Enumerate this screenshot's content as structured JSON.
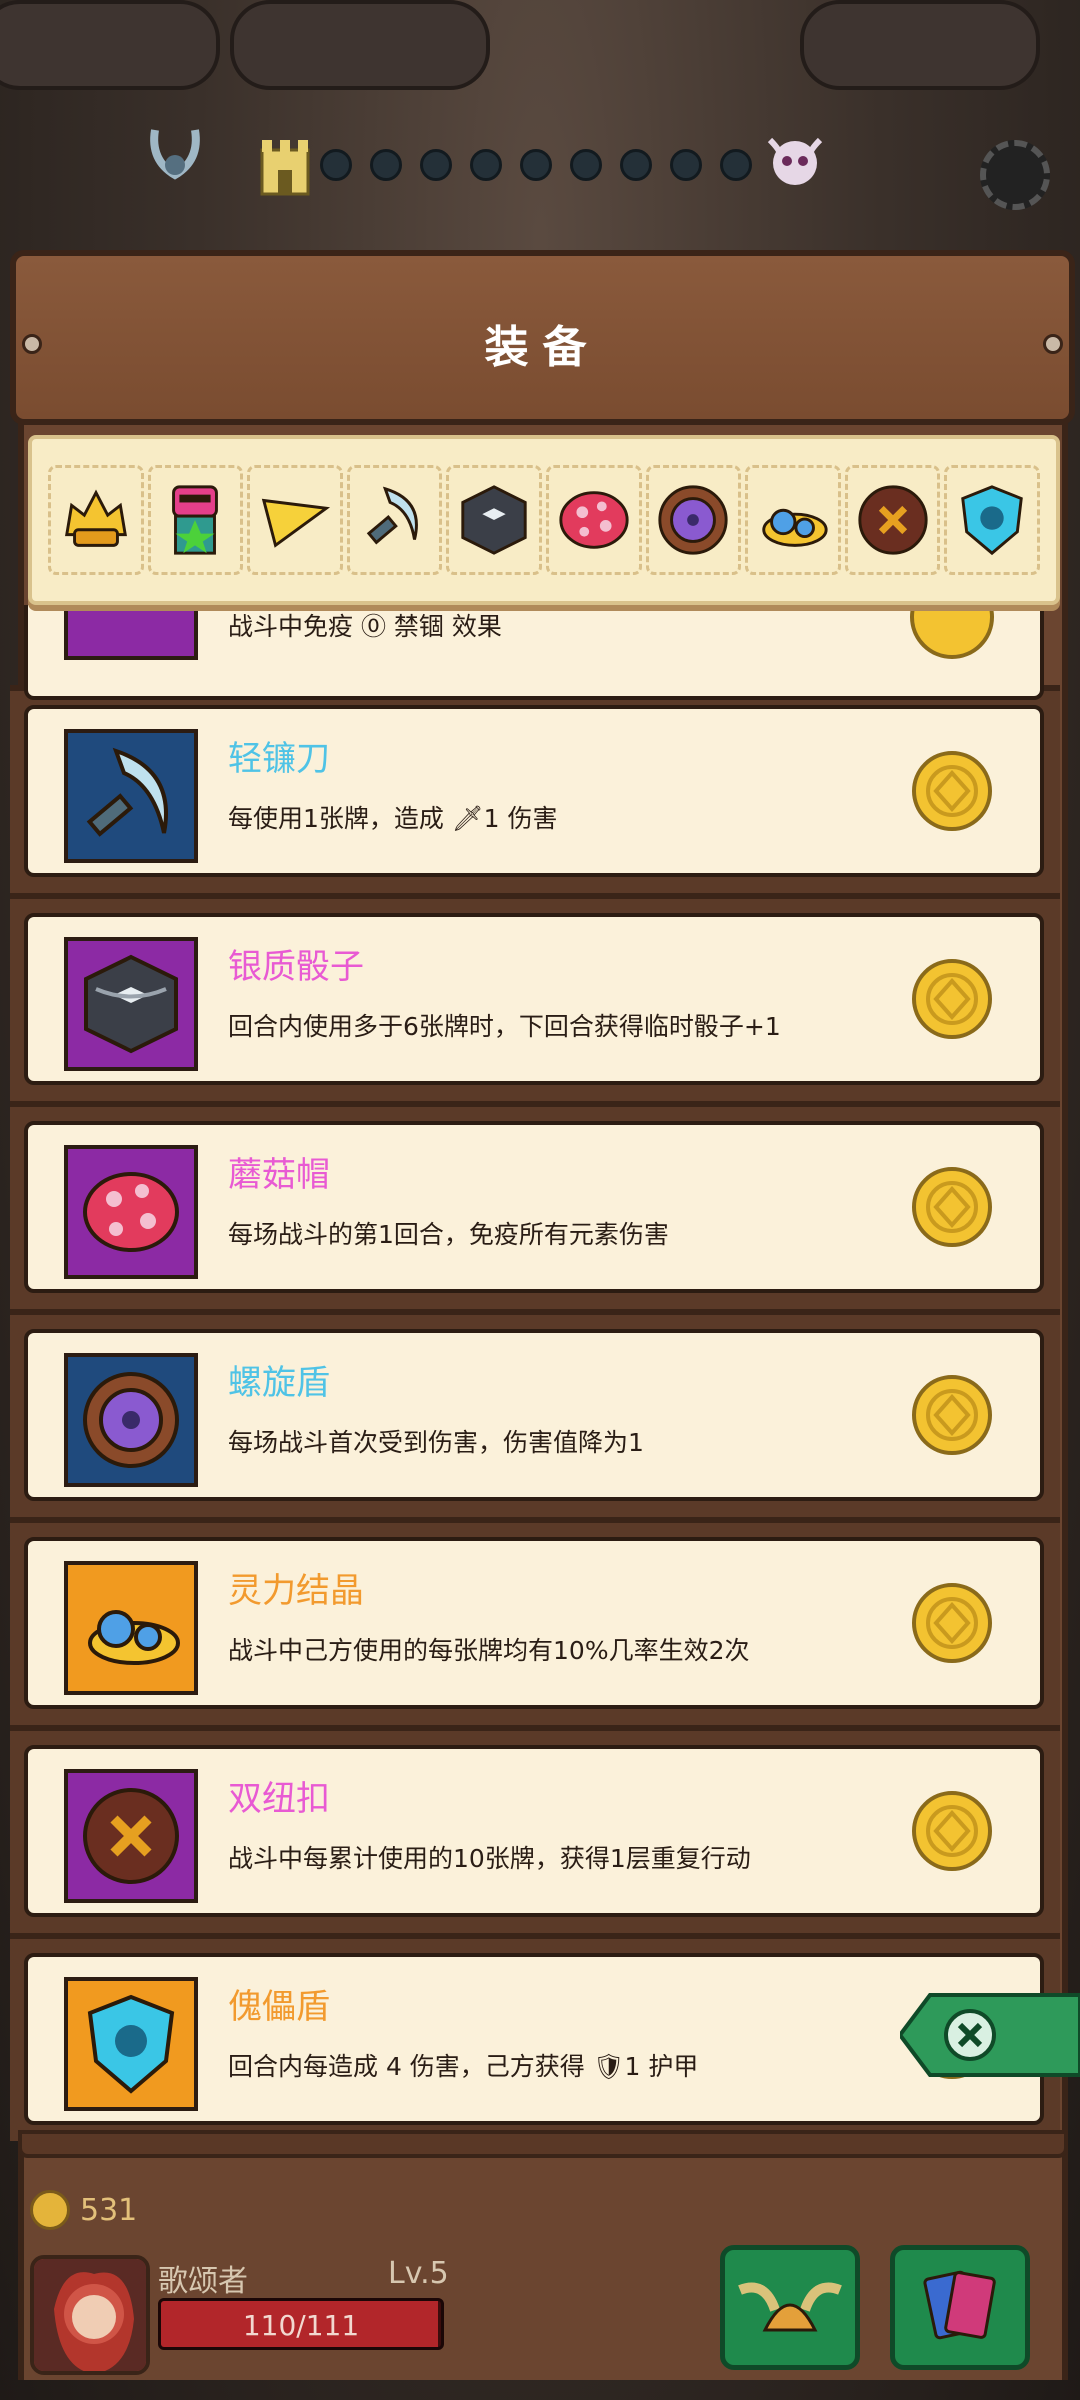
{
  "panel": {
    "title": "装备"
  },
  "strip": {
    "icons": [
      "golden-helmet-icon",
      "totem-icon",
      "cheese-wedge-icon",
      "light-sickle-icon",
      "silver-dice-icon",
      "mushroom-cap-icon",
      "spiral-shield-icon",
      "spirit-crystal-icon",
      "double-button-icon",
      "puppet-shield-icon"
    ]
  },
  "partial_item": {
    "desc": "战斗中免疫 ⓪ 禁锢 效果"
  },
  "items": [
    {
      "name": "轻镰刀",
      "name_color": "#4fc3e6",
      "desc": "每使用1张牌，造成 🗡1 伤害",
      "bg": "blue",
      "icon": "light-sickle-icon"
    },
    {
      "name": "银质骰子",
      "name_color": "#e85ad3",
      "desc": "回合内使用多于6张牌时，下回合获得临时骰子+1",
      "bg": "purple",
      "icon": "silver-dice-icon"
    },
    {
      "name": "蘑菇帽",
      "name_color": "#e85ad3",
      "desc": "每场战斗的第1回合，免疫所有元素伤害",
      "bg": "purple",
      "icon": "mushroom-cap-icon"
    },
    {
      "name": "螺旋盾",
      "name_color": "#4fc3e6",
      "desc": "每场战斗首次受到伤害，伤害值降为1",
      "bg": "blue",
      "icon": "spiral-shield-icon"
    },
    {
      "name": "灵力结晶",
      "name_color": "#f29a2e",
      "desc": "战斗中己方使用的每张牌均有10%几率生效2次",
      "bg": "orange",
      "icon": "spirit-crystal-icon"
    },
    {
      "name": "双纽扣",
      "name_color": "#e85ad3",
      "desc": "战斗中每累计使用的10张牌，获得1层重复行动",
      "bg": "purple",
      "icon": "double-button-icon"
    },
    {
      "name": "傀儡盾",
      "name_color": "#f29a2e",
      "desc": "回合内每造成 4 伤害，己方获得 🛡1 护甲",
      "bg": "orange",
      "icon": "puppet-shield-icon"
    }
  ],
  "hud": {
    "gold": "531",
    "player_name": "歌颂者",
    "level": "Lv.5",
    "hp_text": "110/111",
    "hp_current": 110,
    "hp_max": 111
  },
  "colors": {
    "panel_wood": "#7a4c30",
    "card_bg": "#fbf1da",
    "close_green": "#2e9a5a"
  }
}
